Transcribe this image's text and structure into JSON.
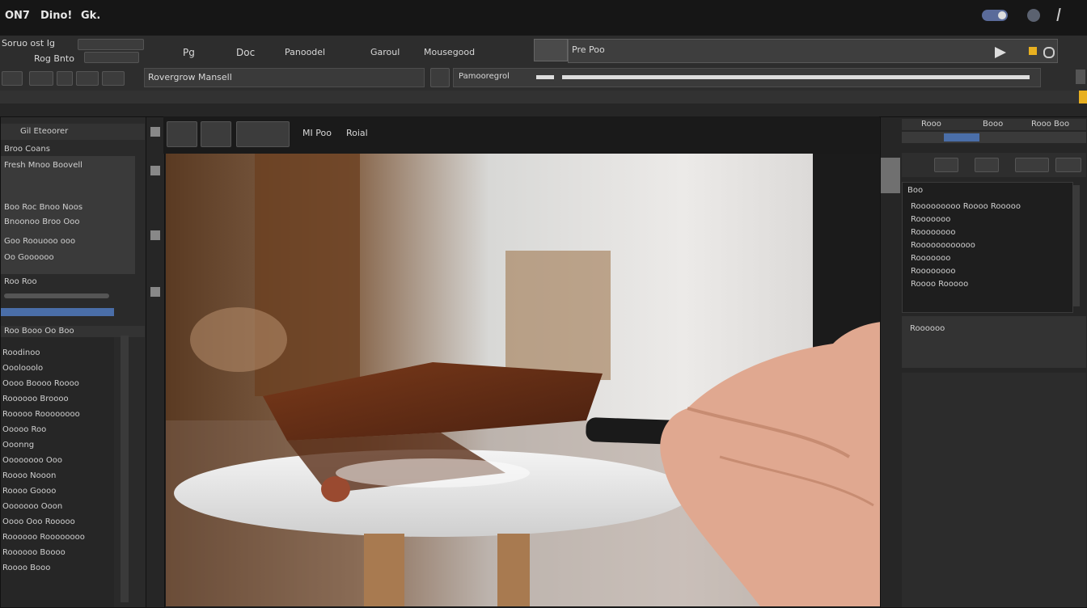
{
  "menubar": {
    "items": [
      "ON7",
      "Dino!",
      "Gk."
    ]
  },
  "toolbar": {
    "row1_items": [
      "Pg",
      "Doc",
      "Panoodel",
      "Garoul",
      "Mousegood"
    ],
    "doc_tab": "Pre Poo",
    "options_label": "Rovergrow Mansell",
    "address_label": "Pamooregrol"
  },
  "left_panel": {
    "title_rows": [
      "Soruo ost Ig",
      "Rog Bnto"
    ],
    "header": "Gil Eteoorer",
    "group_label": "Broo Coans",
    "rows": [
      "Fresh Mnoo Boovell",
      "Boo Roc Bnoo Noos",
      "Bnoonoo Broo Ooo",
      "Goo Roouooo ooo",
      "Oo Goooooo"
    ],
    "slider_label": "Roo Roo",
    "layers_header": "Roo Booo Oo Boo",
    "layers": [
      "Roodinoo",
      "Ooolooolo",
      "Oooo Boooo Roooo",
      "Roooooo Broooo",
      "Rooooo Roooooooo",
      "Ooooo Roo",
      "Ooonng",
      "Oooooooo Ooo",
      "Roooo Nooon",
      "Roooo Goooo",
      "Ooooooo Ooon",
      "Oooo Ooo Rooooo",
      "Roooooo Roooooooo",
      "Roooooo Boooo",
      "Roooo Booo"
    ]
  },
  "document": {
    "title": "MI Poo",
    "subtitle": "Roial"
  },
  "right_panel": {
    "tabs": [
      "Rooo",
      "Booo",
      "Rooo Boo"
    ],
    "list_header": "Boo",
    "items": [
      "Rooooooooo Roooo Rooooo",
      "Rooooooo",
      "Roooooooo",
      "Roooooooooooo",
      "Rooooooo",
      "Roooooooo",
      "Roooo Rooooo"
    ],
    "preview_label": "Roooooo"
  },
  "colors": {
    "accent": "#e8b020",
    "toggle": "#5a6b9a",
    "selection": "#4a6ea8"
  }
}
